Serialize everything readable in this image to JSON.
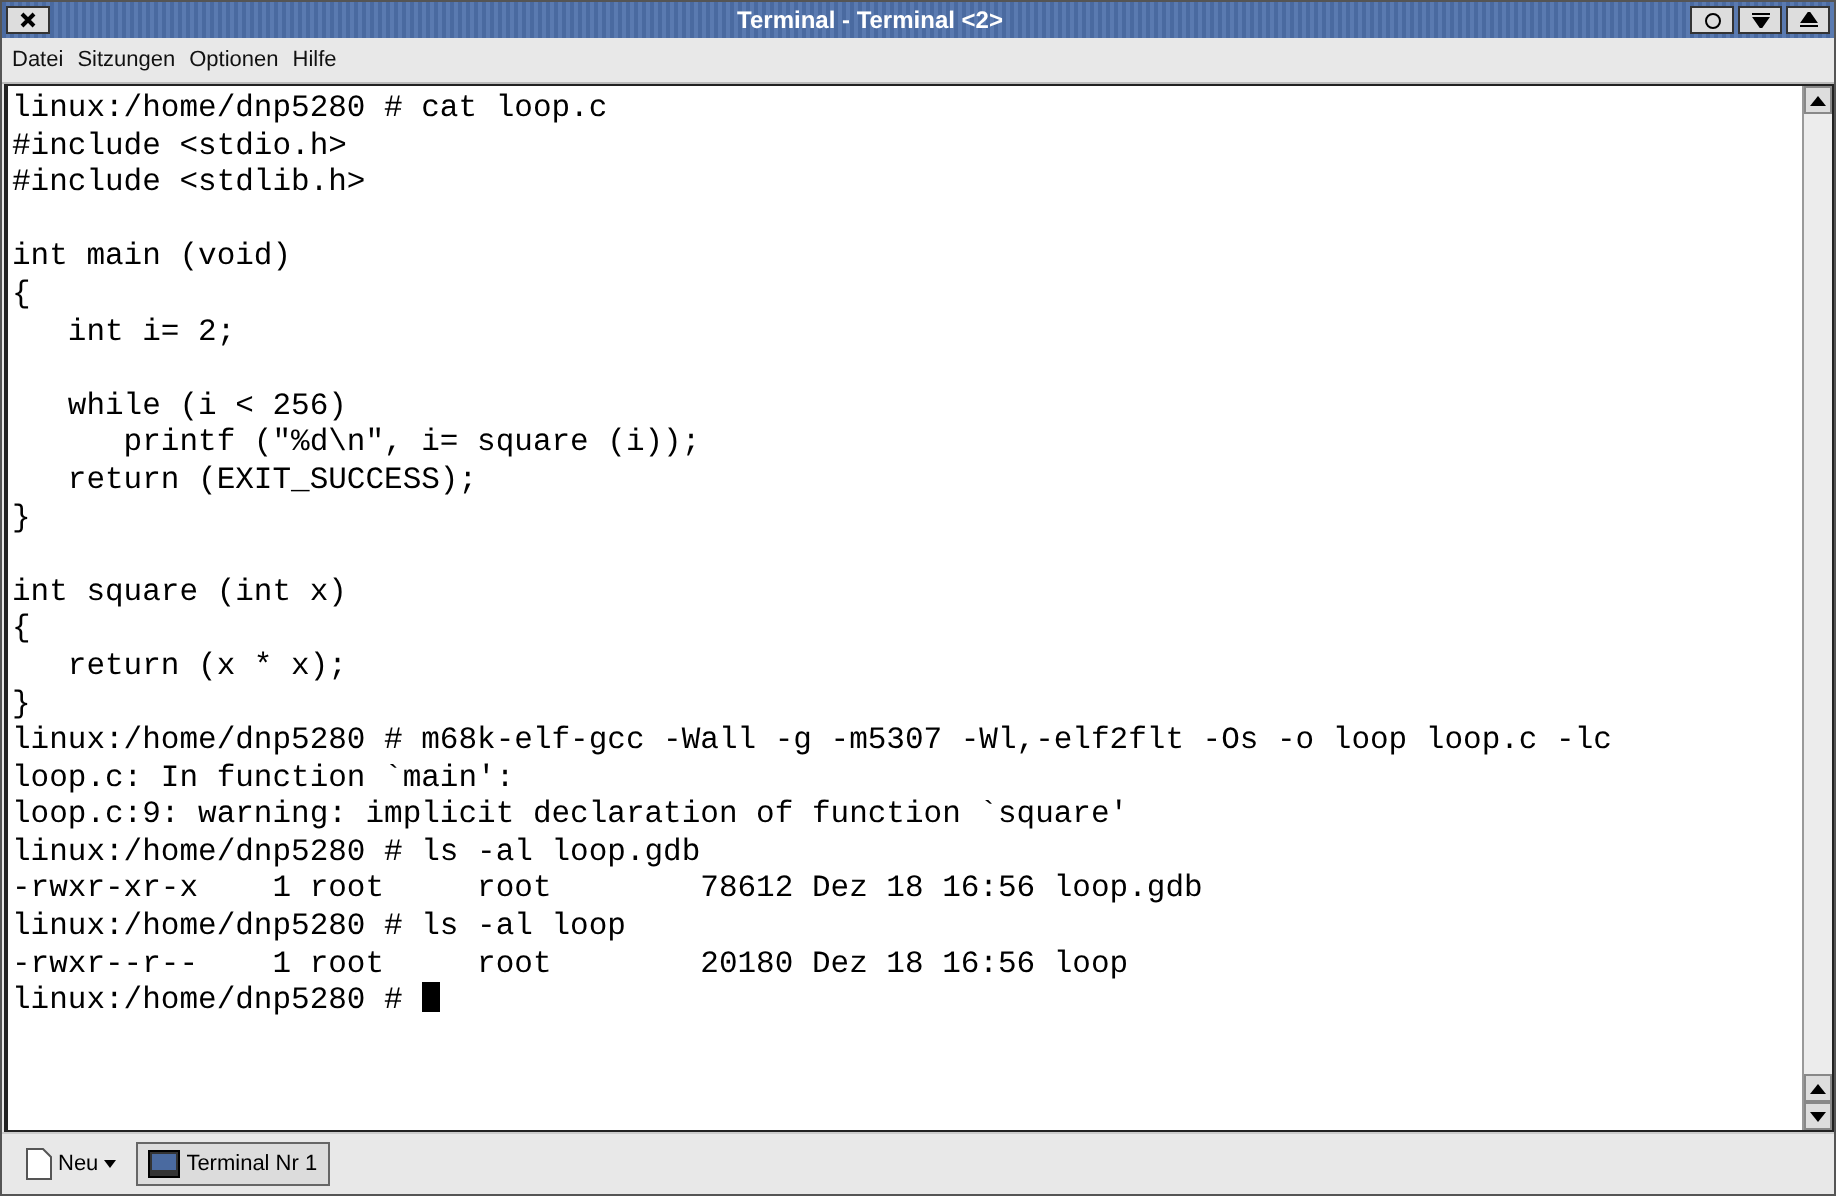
{
  "window": {
    "title": "Terminal - Terminal <2>"
  },
  "menu": [
    "Datei",
    "Sitzungen",
    "Optionen",
    "Hilfe"
  ],
  "terminal": {
    "lines": [
      {
        "kind": "text",
        "text": "linux:/home/dnp5280 # cat loop.c"
      },
      {
        "kind": "text",
        "text": "#include <stdio.h>"
      },
      {
        "kind": "text",
        "text": "#include <stdlib.h>"
      },
      {
        "kind": "blank"
      },
      {
        "kind": "text",
        "text": "int main (void)"
      },
      {
        "kind": "text",
        "text": "{"
      },
      {
        "kind": "text",
        "text": "   int i= 2;"
      },
      {
        "kind": "blank"
      },
      {
        "kind": "text",
        "text": "   while (i < 256)"
      },
      {
        "kind": "text",
        "text": "      printf (\"%d\\n\", i= square (i));"
      },
      {
        "kind": "text",
        "text": "   return (EXIT_SUCCESS);"
      },
      {
        "kind": "text",
        "text": "}"
      },
      {
        "kind": "blank"
      },
      {
        "kind": "text",
        "text": "int square (int x)"
      },
      {
        "kind": "text",
        "text": "{"
      },
      {
        "kind": "text",
        "text": "   return (x * x);"
      },
      {
        "kind": "text",
        "text": "}"
      },
      {
        "kind": "text",
        "text": "linux:/home/dnp5280 # m68k-elf-gcc -Wall -g -m5307 -Wl,-elf2flt -Os -o loop loop.c -lc"
      },
      {
        "kind": "text",
        "text": "loop.c: In function `main':"
      },
      {
        "kind": "text",
        "text": "loop.c:9: warning: implicit declaration of function `square'"
      },
      {
        "kind": "text",
        "text": "linux:/home/dnp5280 # ls -al loop.gdb"
      },
      {
        "kind": "text",
        "text": "-rwxr-xr-x    1 root     root        78612 Dez 18 16:56 loop.gdb"
      },
      {
        "kind": "text",
        "text": "linux:/home/dnp5280 # ls -al loop"
      },
      {
        "kind": "text",
        "text": "-rwxr--r--    1 root     root        20180 Dez 18 16:56 loop"
      },
      {
        "kind": "prompt",
        "text": "linux:/home/dnp5280 # "
      }
    ]
  },
  "taskbar": {
    "new_button": "Neu",
    "sessions": [
      {
        "label": "Terminal Nr 1",
        "selected": true
      }
    ]
  }
}
